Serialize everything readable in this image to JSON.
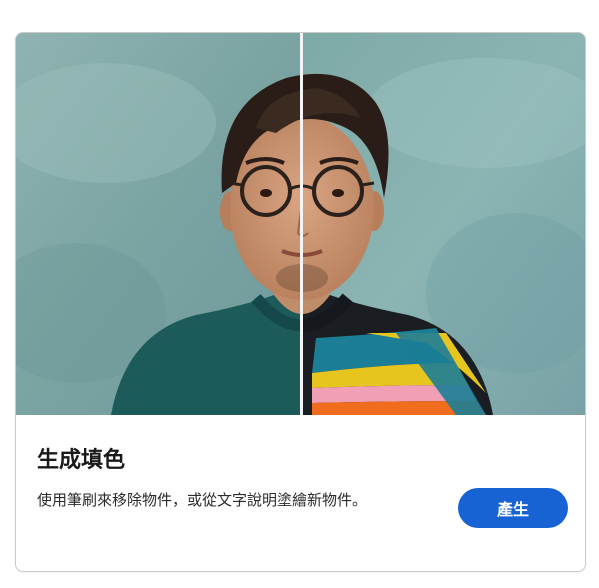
{
  "card": {
    "title": "生成填色",
    "description": "使用筆刷來移除物件，或從文字說明塗繪新物件。",
    "button_label": "產生"
  },
  "colors": {
    "accent": "#1763d4",
    "wall_teal": "#7fa7a6",
    "sweater_green": "#1d5a5a"
  },
  "image": {
    "subject": "before-after portrait split"
  }
}
